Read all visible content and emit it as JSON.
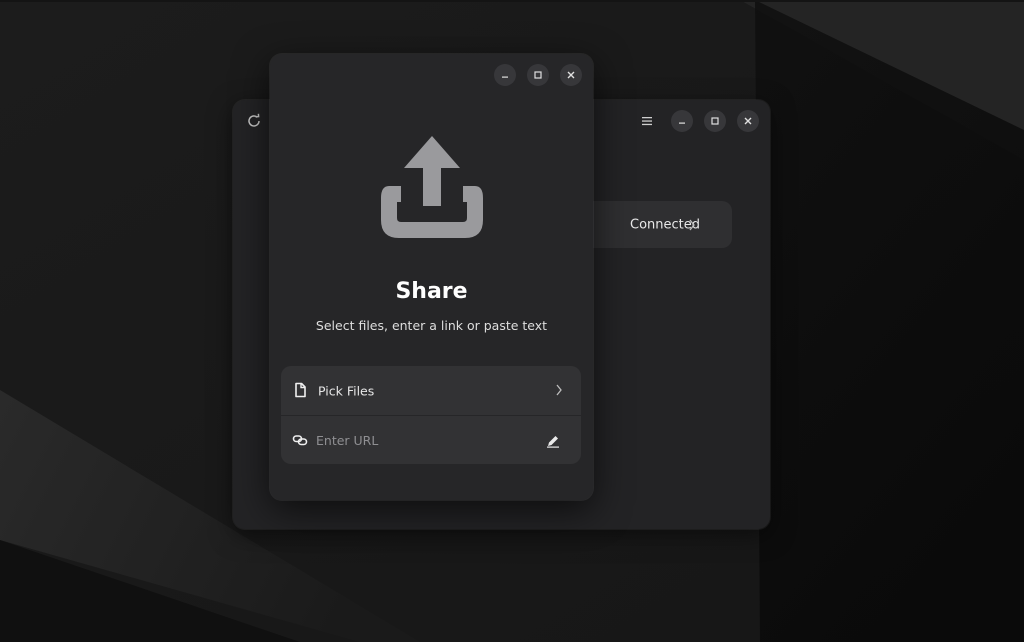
{
  "colors": {
    "window_bg": "#262628",
    "back_window_bg": "#232325",
    "row_bg": "#323234",
    "icon_gray": "#9a9a9d"
  },
  "back_window": {
    "icons": [
      "refresh-icon",
      "hamburger-menu-icon",
      "minimize-icon",
      "maximize-icon",
      "close-icon"
    ],
    "connected_label": "Connected"
  },
  "share_dialog": {
    "title": "Share",
    "subtitle": "Select files, enter a link or paste text",
    "hero_icon": "share-upload-icon",
    "pick_files_label": "Pick Files",
    "url_placeholder": "Enter URL",
    "url_value": "",
    "icons": [
      "file-icon",
      "link-icon",
      "edit-pencil-icon",
      "chevron-right-icon"
    ]
  }
}
